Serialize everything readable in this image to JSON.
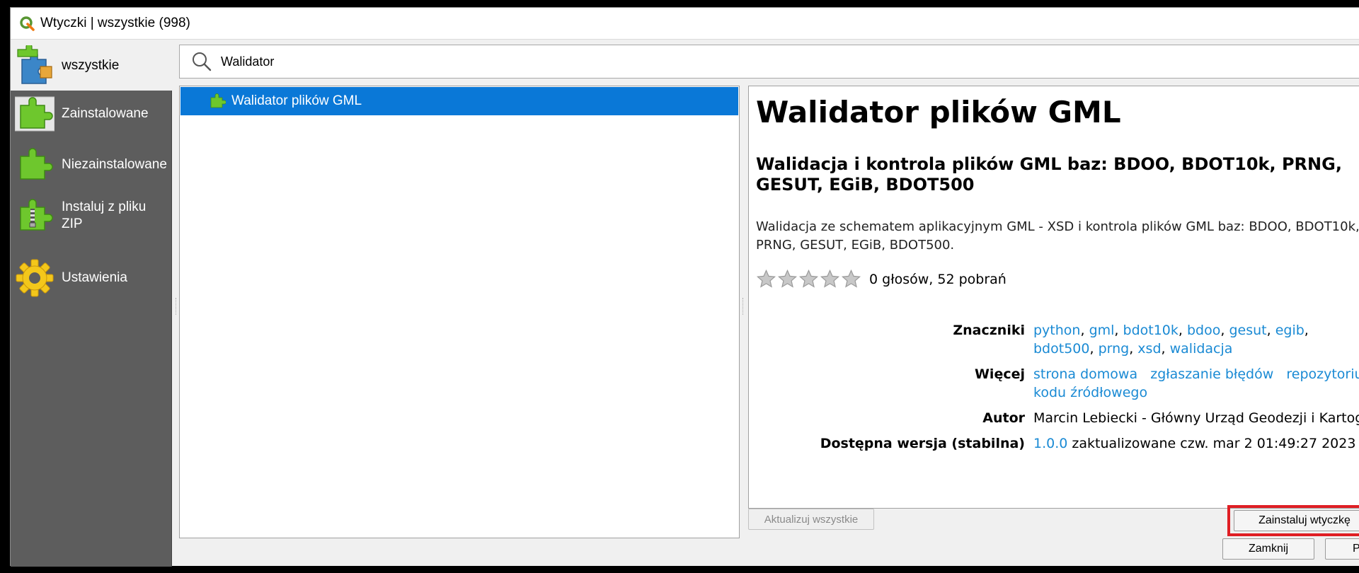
{
  "window": {
    "title": "Wtyczki | wszystkie (998)"
  },
  "sidebar": {
    "top_item": "wszystkie",
    "items": [
      {
        "label": "Zainstalowane",
        "icon": "puzzle-installed-icon"
      },
      {
        "label": "Niezainstalowane",
        "icon": "puzzle-not-installed-icon"
      },
      {
        "label": "Instaluj z pliku ZIP",
        "icon": "puzzle-zip-icon"
      },
      {
        "label": "Ustawienia",
        "icon": "gear-icon"
      }
    ]
  },
  "search": {
    "value": "Walidator",
    "icon": "search-icon"
  },
  "plugin_list": {
    "items": [
      {
        "label": "Walidator plików GML",
        "selected": true
      }
    ]
  },
  "details": {
    "title": "Walidator plików GML",
    "subtitle": "Walidacja i kontrola plików GML baz: BDOO, BDOT10k, PRNG, GESUT, EGiB, BDOT500",
    "description": "Walidacja ze schematem aplikacyjnym GML - XSD i kontrola plików GML baz: BDOO, BDOT10k, PRNG, GESUT, EGiB, BDOT500.",
    "rating": {
      "stars": 0,
      "max_stars": 5,
      "text": "0 głosów, 52 pobrań"
    },
    "tags_label": "Znaczniki",
    "tags": [
      "python",
      "gml",
      "bdot10k",
      "bdoo",
      "gesut",
      "egib",
      "bdot500",
      "prng",
      "xsd",
      "walidacja"
    ],
    "more_label": "Więcej",
    "more_links": {
      "homepage": "strona domowa",
      "bug_tracker": "zgłaszanie błędów",
      "repository": "repozytorium kodu źródłowego"
    },
    "author_label": "Autor",
    "author_value": "Marcin Lebiecki - Główny Urząd Geodezji i Kartografii",
    "version_label": "Dostępna wersja (stabilna)",
    "version_number": "1.0.0",
    "version_updated": "zaktualizowane czw. mar 2 01:49:27 2023"
  },
  "buttons": {
    "update_all": "Aktualizuj wszystkie",
    "install": "Zainstaluj wtyczkę",
    "close": "Zamknij",
    "help": "Pomoc"
  },
  "colors": {
    "selection": "#0a78d7",
    "sidebar": "#5d5d5d",
    "link": "#1a8ad4",
    "highlight": "#e01e24",
    "puzzle_green": "#6ec72d"
  }
}
